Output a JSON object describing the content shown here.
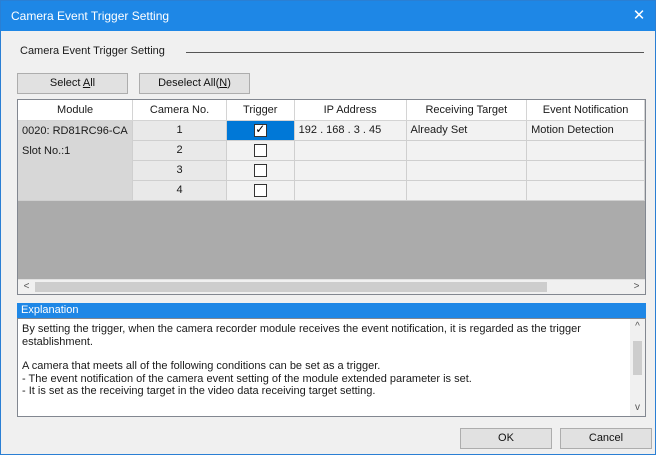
{
  "window": {
    "title": "Camera Event Trigger Setting",
    "close_glyph": "✕"
  },
  "group": {
    "label": "Camera Event Trigger Setting"
  },
  "buttons": {
    "select_all": {
      "pre": "Select ",
      "mnemonic": "A",
      "post": "ll"
    },
    "deselect_all": {
      "pre": "Deselect All(",
      "mnemonic": "N",
      "post": ")"
    },
    "ok": "OK",
    "cancel": "Cancel"
  },
  "grid": {
    "columns": [
      "Module",
      "Camera No.",
      "Trigger",
      "IP Address",
      "Receiving Target",
      "Event Notification"
    ],
    "module": {
      "line1": "0020: RD81RC96-CA",
      "line2": "Slot No.:1"
    },
    "rows": [
      {
        "camera_no": "1",
        "trigger": true,
        "ip": "192 . 168 . 3 . 45",
        "receiving_target": "Already Set",
        "event_notification": "Motion Detection"
      },
      {
        "camera_no": "2",
        "trigger": false,
        "ip": "",
        "receiving_target": "",
        "event_notification": ""
      },
      {
        "camera_no": "3",
        "trigger": false,
        "ip": "",
        "receiving_target": "",
        "event_notification": ""
      },
      {
        "camera_no": "4",
        "trigger": false,
        "ip": "",
        "receiving_target": "",
        "event_notification": ""
      }
    ],
    "checkmark_glyph": "✓",
    "scroll_left_glyph": "<",
    "scroll_right_glyph": ">"
  },
  "explanation": {
    "header": "Explanation",
    "paragraphs": [
      "By setting the trigger, when the camera recorder module receives the event notification,  it is regarded as the trigger establishment.",
      "",
      "A camera that meets all of the following conditions can be set as a trigger.",
      "- The event notification of the camera event setting of the module extended parameter is set.",
      "- It is set as the receiving target in the video data receiving target setting."
    ],
    "scroll_up_glyph": "^",
    "scroll_down_glyph": "v"
  },
  "colors": {
    "accent": "#1e87e6",
    "selection": "#0078d7"
  }
}
